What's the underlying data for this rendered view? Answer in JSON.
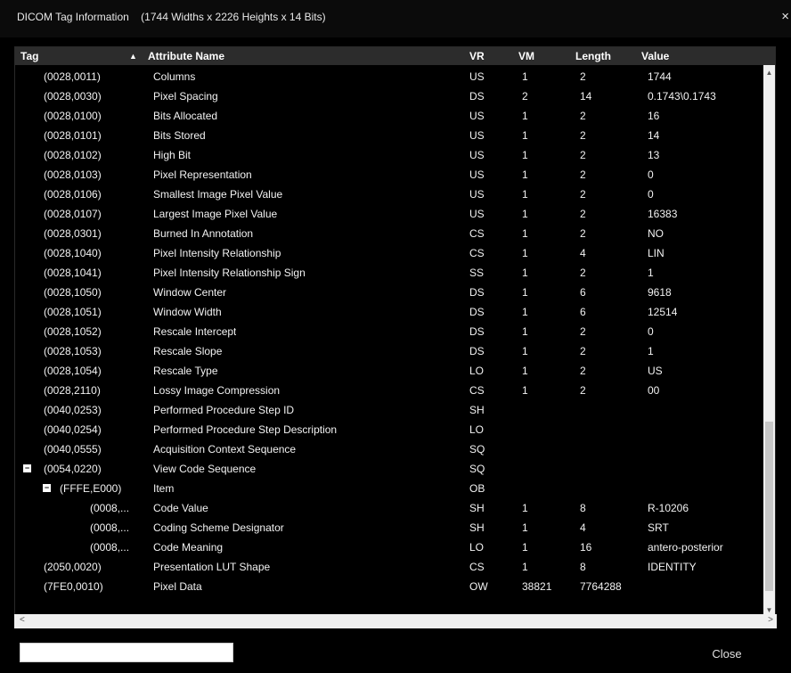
{
  "window": {
    "title": "DICOM Tag Information",
    "subtitle": "(1744 Widths x 2226 Heights x 14 Bits)",
    "close_glyph": "×"
  },
  "columns": {
    "tag": "Tag",
    "attribute": "Attribute Name",
    "vr": "VR",
    "vm": "VM",
    "length": "Length",
    "value": "Value"
  },
  "rows": [
    {
      "tag": "(0028,0011)",
      "attr": "Columns",
      "vr": "US",
      "vm": "1",
      "len": "2",
      "val": "1744",
      "level": 0
    },
    {
      "tag": "(0028,0030)",
      "attr": "Pixel Spacing",
      "vr": "DS",
      "vm": "2",
      "len": "14",
      "val": "0.1743\\0.1743",
      "level": 0
    },
    {
      "tag": "(0028,0100)",
      "attr": "Bits Allocated",
      "vr": "US",
      "vm": "1",
      "len": "2",
      "val": "16",
      "level": 0
    },
    {
      "tag": "(0028,0101)",
      "attr": "Bits Stored",
      "vr": "US",
      "vm": "1",
      "len": "2",
      "val": "14",
      "level": 0
    },
    {
      "tag": "(0028,0102)",
      "attr": "High Bit",
      "vr": "US",
      "vm": "1",
      "len": "2",
      "val": "13",
      "level": 0
    },
    {
      "tag": "(0028,0103)",
      "attr": "Pixel Representation",
      "vr": "US",
      "vm": "1",
      "len": "2",
      "val": "0",
      "level": 0
    },
    {
      "tag": "(0028,0106)",
      "attr": "Smallest Image Pixel Value",
      "vr": "US",
      "vm": "1",
      "len": "2",
      "val": "0",
      "level": 0
    },
    {
      "tag": "(0028,0107)",
      "attr": "Largest Image Pixel Value",
      "vr": "US",
      "vm": "1",
      "len": "2",
      "val": "16383",
      "level": 0
    },
    {
      "tag": "(0028,0301)",
      "attr": "Burned In Annotation",
      "vr": "CS",
      "vm": "1",
      "len": "2",
      "val": "NO",
      "level": 0
    },
    {
      "tag": "(0028,1040)",
      "attr": "Pixel Intensity Relationship",
      "vr": "CS",
      "vm": "1",
      "len": "4",
      "val": "LIN",
      "level": 0
    },
    {
      "tag": "(0028,1041)",
      "attr": "Pixel Intensity Relationship Sign",
      "vr": "SS",
      "vm": "1",
      "len": "2",
      "val": "1",
      "level": 0
    },
    {
      "tag": "(0028,1050)",
      "attr": "Window Center",
      "vr": "DS",
      "vm": "1",
      "len": "6",
      "val": "9618",
      "level": 0
    },
    {
      "tag": "(0028,1051)",
      "attr": "Window Width",
      "vr": "DS",
      "vm": "1",
      "len": "6",
      "val": "12514",
      "level": 0
    },
    {
      "tag": "(0028,1052)",
      "attr": "Rescale Intercept",
      "vr": "DS",
      "vm": "1",
      "len": "2",
      "val": "0",
      "level": 0
    },
    {
      "tag": "(0028,1053)",
      "attr": "Rescale Slope",
      "vr": "DS",
      "vm": "1",
      "len": "2",
      "val": "1",
      "level": 0
    },
    {
      "tag": "(0028,1054)",
      "attr": "Rescale Type",
      "vr": "LO",
      "vm": "1",
      "len": "2",
      "val": "US",
      "level": 0
    },
    {
      "tag": "(0028,2110)",
      "attr": "Lossy Image Compression",
      "vr": "CS",
      "vm": "1",
      "len": "2",
      "val": "00",
      "level": 0
    },
    {
      "tag": "(0040,0253)",
      "attr": "Performed Procedure Step ID",
      "vr": "SH",
      "vm": "",
      "len": "",
      "val": "",
      "level": 0
    },
    {
      "tag": "(0040,0254)",
      "attr": "Performed Procedure Step Description",
      "vr": "LO",
      "vm": "",
      "len": "",
      "val": "",
      "level": 0
    },
    {
      "tag": "(0040,0555)",
      "attr": "Acquisition Context Sequence",
      "vr": "SQ",
      "vm": "",
      "len": "",
      "val": "",
      "level": 0
    },
    {
      "tag": "(0054,0220)",
      "attr": "View Code Sequence",
      "vr": "SQ",
      "vm": "",
      "len": "",
      "val": "",
      "level": 0,
      "toggle": "−"
    },
    {
      "tag": "(FFFE,E000)",
      "attr": "Item",
      "vr": "OB",
      "vm": "",
      "len": "",
      "val": "",
      "level": 1,
      "toggle": "−"
    },
    {
      "tag": "(0008,...",
      "attr": "Code Value",
      "vr": "SH",
      "vm": "1",
      "len": "8",
      "val": "R-10206",
      "level": 2
    },
    {
      "tag": "(0008,...",
      "attr": "Coding Scheme Designator",
      "vr": "SH",
      "vm": "1",
      "len": "4",
      "val": "SRT",
      "level": 2
    },
    {
      "tag": "(0008,...",
      "attr": "Code Meaning",
      "vr": "LO",
      "vm": "1",
      "len": "16",
      "val": "antero-posterior",
      "level": 2
    },
    {
      "tag": "(2050,0020)",
      "attr": "Presentation LUT Shape",
      "vr": "CS",
      "vm": "1",
      "len": "8",
      "val": "IDENTITY",
      "level": 0
    },
    {
      "tag": "(7FE0,0010)",
      "attr": "Pixel Data",
      "vr": "OW",
      "vm": "38821",
      "len": "7764288",
      "val": "",
      "level": 0
    }
  ],
  "search": {
    "value": "",
    "placeholder": ""
  },
  "footer": {
    "close_label": "Close"
  }
}
